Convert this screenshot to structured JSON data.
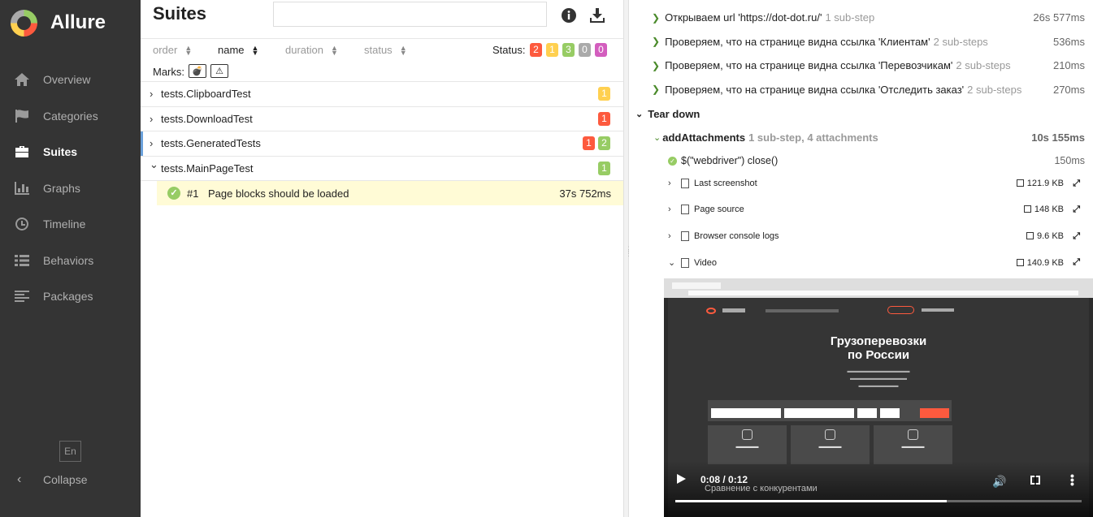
{
  "app": {
    "name": "Allure"
  },
  "sidebar": {
    "items": [
      {
        "label": "Overview",
        "icon": "home-icon"
      },
      {
        "label": "Categories",
        "icon": "flag-icon"
      },
      {
        "label": "Suites",
        "icon": "briefcase-icon",
        "active": true
      },
      {
        "label": "Graphs",
        "icon": "bar-chart-icon"
      },
      {
        "label": "Timeline",
        "icon": "clock-icon"
      },
      {
        "label": "Behaviors",
        "icon": "list-icon"
      },
      {
        "label": "Packages",
        "icon": "align-left-icon"
      }
    ],
    "language": "En",
    "collapse_label": "Collapse"
  },
  "suites": {
    "title": "Suites",
    "search": {
      "value": "",
      "placeholder": ""
    },
    "sort": {
      "order": "order",
      "name": "name",
      "duration": "duration",
      "status": "status"
    },
    "status_label": "Status:",
    "status_counts": [
      {
        "value": "2",
        "color": "#fd5a3e"
      },
      {
        "value": "1",
        "color": "#ffd050"
      },
      {
        "value": "3",
        "color": "#97cc64"
      },
      {
        "value": "0",
        "color": "#aaaaaa"
      },
      {
        "value": "0",
        "color": "#d35ebe"
      }
    ],
    "marks_label": "Marks:",
    "tree": [
      {
        "name": "tests.ClipboardTest",
        "badges": [
          {
            "value": "1",
            "color": "#ffd050"
          }
        ]
      },
      {
        "name": "tests.DownloadTest",
        "badges": [
          {
            "value": "1",
            "color": "#fd5a3e"
          }
        ]
      },
      {
        "name": "tests.GeneratedTests",
        "badges": [
          {
            "value": "1",
            "color": "#fd5a3e"
          },
          {
            "value": "2",
            "color": "#97cc64"
          }
        ]
      },
      {
        "name": "tests.MainPageTest",
        "badges": [
          {
            "value": "1",
            "color": "#97cc64"
          }
        ]
      }
    ],
    "selected_test": {
      "number": "#1",
      "name": "Page blocks should be loaded",
      "duration": "37s 752ms"
    }
  },
  "details": {
    "steps": [
      {
        "label": "Открываем url 'https://dot-dot.ru/'",
        "sub": "1 sub-step",
        "duration": "26s 577ms"
      },
      {
        "label": "Проверяем, что на странице видна ссылка 'Клиентам'",
        "sub": "2 sub-steps",
        "duration": "536ms"
      },
      {
        "label": "Проверяем, что на странице видна ссылка 'Перевозчикам'",
        "sub": "2 sub-steps",
        "duration": "210ms"
      },
      {
        "label": "Проверяем, что на странице видна ссылка 'Отследить заказ'",
        "sub": "2 sub-steps",
        "duration": "270ms"
      }
    ],
    "teardown_label": "Tear down",
    "fixture": {
      "name": "addAttachments",
      "sub": "1 sub-step, 4 attachments",
      "duration": "10s 155ms"
    },
    "close_step": {
      "label": "$(\"webdriver\") close()",
      "duration": "150ms"
    },
    "attachments": [
      {
        "name": "Last screenshot",
        "size": "121.9 KB"
      },
      {
        "name": "Page source",
        "size": "148 KB"
      },
      {
        "name": "Browser console logs",
        "size": "9.6 KB"
      },
      {
        "name": "Video",
        "size": "140.9 KB"
      }
    ],
    "video": {
      "headline_1": "Грузоперевозки",
      "headline_2": "по России",
      "time": "0:08 / 0:12",
      "progress": 0.667,
      "caption": "Сравнение с конкурентами"
    }
  }
}
